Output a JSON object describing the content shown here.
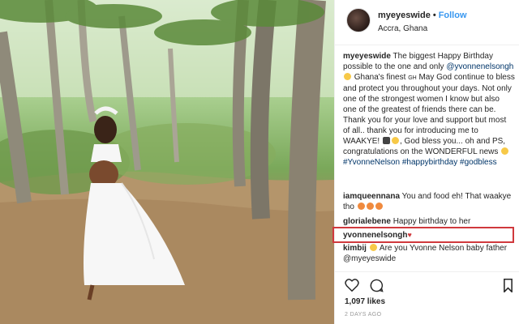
{
  "post": {
    "username": "myeyeswide",
    "separator": "•",
    "follow_label": "Follow",
    "location": "Accra, Ghana"
  },
  "caption": {
    "author": "myeyeswide",
    "t1": "The biggest Happy Birthday possible to the one and only",
    "mention1": "@yvonnenelsongh",
    "t2": "Ghana's finest",
    "gh": "GH",
    "t3": "May God continue to bless and protect you throughout your days. Not only one of the strongest women I know but also one of the greatest of friends there can be. Thank you for your love and support but most of all.. thank you for introducing me to WAAKYE!",
    "t4": ", God bless you... oh and PS, congratulations on the WONDERFUL news",
    "tag1": "#YvonneNelson",
    "tag2": "#happybirthday",
    "tag3": "#godbless"
  },
  "comments": [
    {
      "user": "iamqueennana",
      "text": "You and food eh! That waakye tho"
    },
    {
      "user": "glorialebene",
      "text": "Happy birthday to her"
    },
    {
      "user": "yvonnenelsongh",
      "text": ""
    },
    {
      "user": "kimbij",
      "text": "Are you Yvonne Nelson baby father",
      "mention": "@myeyeswide"
    }
  ],
  "actions": {
    "like_icon": "heart-icon",
    "comment_icon": "comment-icon",
    "save_icon": "bookmark-icon"
  },
  "likes_text": "1,097 likes",
  "time_ago": "2 DAYS AGO",
  "colors": {
    "link": "#003569",
    "follow": "#3897f0",
    "highlight_border": "#d0393d"
  }
}
